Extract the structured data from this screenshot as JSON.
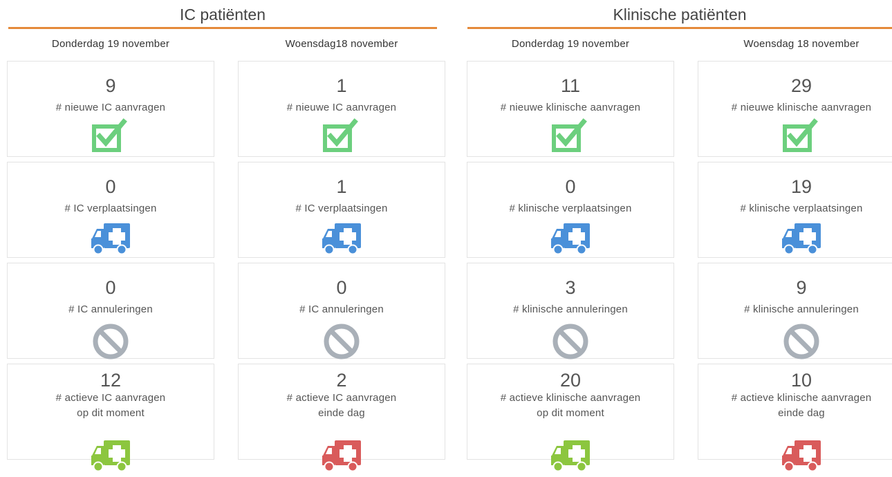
{
  "sections": [
    {
      "title": "IC patiënten"
    },
    {
      "title": "Klinische patiënten"
    }
  ],
  "columns": [
    {
      "date": "Donderdag 19 november",
      "cards": [
        {
          "value": "9",
          "label1": "# nieuwe IC aanvragen",
          "label2": "",
          "icon": "check-icon",
          "color": "#6ccf7e"
        },
        {
          "value": "0",
          "label1": "# IC verplaatsingen",
          "label2": "",
          "icon": "ambulance-icon",
          "color": "#4a90d9"
        },
        {
          "value": "0",
          "label1": "# IC annuleringen",
          "label2": "",
          "icon": "ban-icon",
          "color": "#a9b0b8"
        },
        {
          "value": "12",
          "label1": "# actieve IC aanvragen",
          "label2": "op dit moment",
          "icon": "ambulance-icon",
          "color": "#8cc63f"
        }
      ]
    },
    {
      "date": "Woensdag18 november",
      "cards": [
        {
          "value": "1",
          "label1": "# nieuwe IC aanvragen",
          "label2": "",
          "icon": "check-icon",
          "color": "#6ccf7e"
        },
        {
          "value": "1",
          "label1": "# IC verplaatsingen",
          "label2": "",
          "icon": "ambulance-icon",
          "color": "#4a90d9"
        },
        {
          "value": "0",
          "label1": "# IC annuleringen",
          "label2": "",
          "icon": "ban-icon",
          "color": "#a9b0b8"
        },
        {
          "value": "2",
          "label1": "# actieve IC aanvragen",
          "label2": "einde dag",
          "icon": "ambulance-icon",
          "color": "#d95b5b"
        }
      ]
    },
    {
      "date": "Donderdag 19 november",
      "cards": [
        {
          "value": "11",
          "label1": "# nieuwe klinische aanvragen",
          "label2": "",
          "icon": "check-icon",
          "color": "#6ccf7e"
        },
        {
          "value": "0",
          "label1": "# klinische verplaatsingen",
          "label2": "",
          "icon": "ambulance-icon",
          "color": "#4a90d9"
        },
        {
          "value": "3",
          "label1": "# klinische annuleringen",
          "label2": "",
          "icon": "ban-icon",
          "color": "#a9b0b8"
        },
        {
          "value": "20",
          "label1": "# actieve klinische aanvragen",
          "label2": "op dit moment",
          "icon": "ambulance-icon",
          "color": "#8cc63f"
        }
      ]
    },
    {
      "date": "Woensdag 18 november",
      "cards": [
        {
          "value": "29",
          "label1": "# nieuwe klinische aanvragen",
          "label2": "",
          "icon": "check-icon",
          "color": "#6ccf7e"
        },
        {
          "value": "19",
          "label1": "# klinische verplaatsingen",
          "label2": "",
          "icon": "ambulance-icon",
          "color": "#4a90d9"
        },
        {
          "value": "9",
          "label1": "# klinische annuleringen",
          "label2": "",
          "icon": "ban-icon",
          "color": "#a9b0b8"
        },
        {
          "value": "10",
          "label1": "# actieve klinische aanvragen",
          "label2": "einde dag",
          "icon": "ambulance-icon",
          "color": "#d95b5b"
        }
      ]
    }
  ],
  "accent_color": "#e58a3a"
}
